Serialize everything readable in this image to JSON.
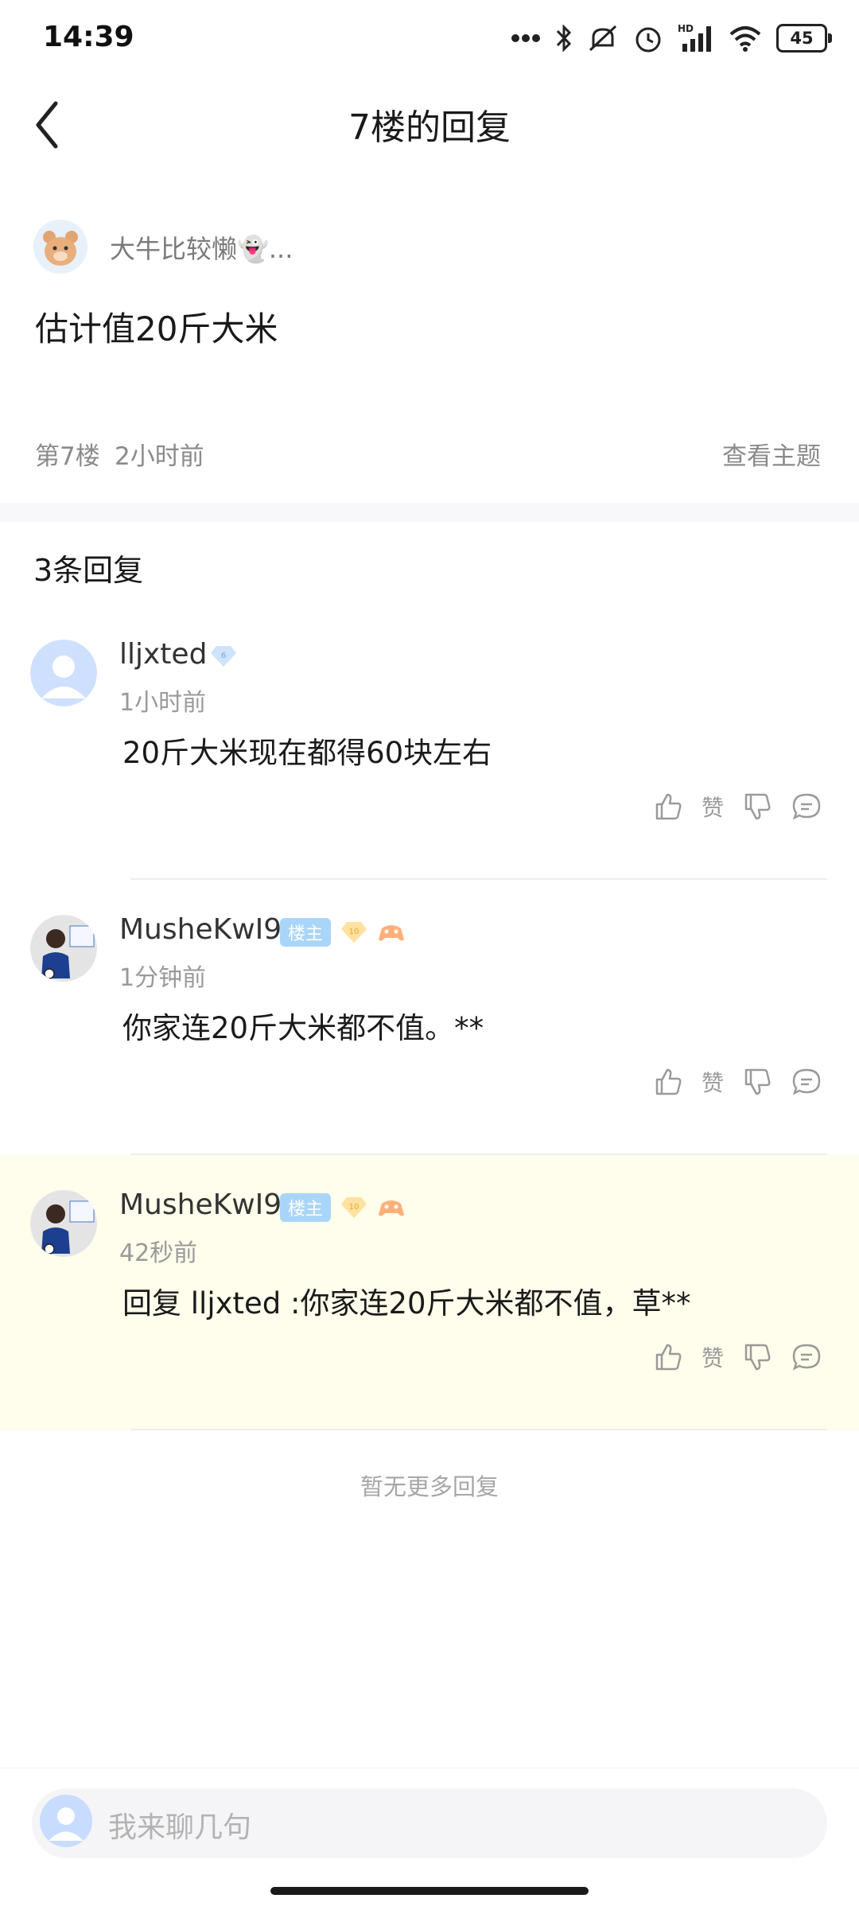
{
  "status_bar": {
    "time": "14:39",
    "battery": "45",
    "icons": [
      "more-dots-icon",
      "bluetooth-icon",
      "mute-icon",
      "alarm-icon",
      "hd-signal-icon",
      "wifi-icon",
      "battery-icon"
    ]
  },
  "header": {
    "title": "7楼的回复"
  },
  "post": {
    "author": "大牛比较懒👻...",
    "content": "估计值20斤大米",
    "floor": "第7楼",
    "time": "2小时前",
    "view_topic": "查看主题"
  },
  "replies_section": {
    "count_label": "3条回复",
    "replies": [
      {
        "username": "lljxted",
        "level": "6",
        "time": "1小时前",
        "text": "20斤大米现在都得60块左右",
        "like_label": "赞"
      },
      {
        "username": "MusheKwI9",
        "owner_badge": "楼主",
        "level": "10",
        "time": "1分钟前",
        "text": "你家连20斤大米都不值。**",
        "like_label": "赞"
      },
      {
        "username": "MusheKwI9",
        "owner_badge": "楼主",
        "level": "10",
        "time": "42秒前",
        "text": "回复 lljxted :你家连20斤大米都不值，草**",
        "like_label": "赞"
      }
    ],
    "no_more": "暂无更多回复"
  },
  "composer": {
    "placeholder": "我来聊几句"
  },
  "colors": {
    "highlight_bg": "#fffdeb",
    "owner_badge": "#a9d6f8",
    "muted_text": "#9a9a9a"
  }
}
